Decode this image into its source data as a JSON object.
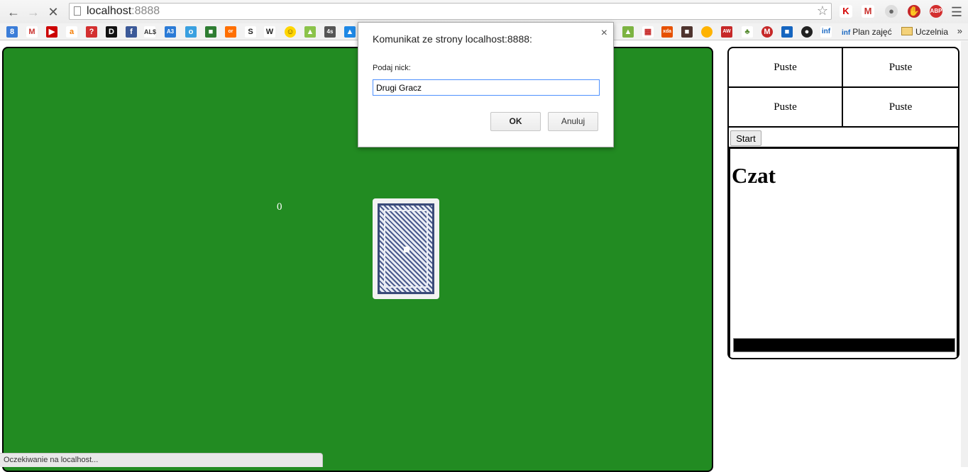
{
  "browser": {
    "url_host": "localhost",
    "url_port": ":8888",
    "bookmarks": {
      "plan_label": "Plan zajęć",
      "uczelnia_label": "Uczelnia",
      "overflow": "»"
    }
  },
  "game": {
    "score": "0",
    "card_state": "face-down"
  },
  "slots": [
    "Puste",
    "Puste",
    "Puste",
    "Puste"
  ],
  "panel": {
    "start_label": "Start",
    "chat_title": "Czat"
  },
  "status_bar": "Oczekiwanie na localhost...",
  "dialog": {
    "title": "Komunikat ze strony localhost:8888:",
    "close": "×",
    "prompt_label": "Podaj nick:",
    "input_value": "Drugi Gracz",
    "ok_label": "OK",
    "cancel_label": "Anuluj"
  },
  "colors": {
    "table_green": "#228b22",
    "card_back": "#4a5a8c"
  }
}
